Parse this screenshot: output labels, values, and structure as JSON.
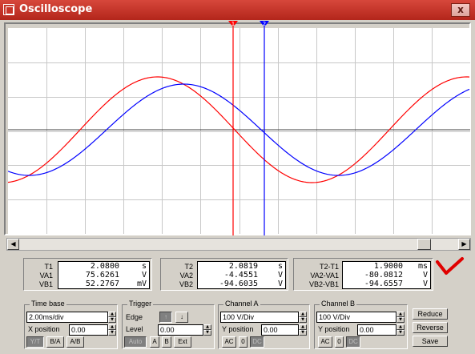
{
  "window": {
    "title": "Oscilloscope",
    "close_glyph": "x"
  },
  "scope": {
    "trace_colors": {
      "channel_a": "#ff0000",
      "channel_b": "#0000ff"
    },
    "cursor_labels": {
      "t1": "1",
      "t2": "2"
    },
    "cursor_colors": {
      "t1": "#ff0000",
      "t2": "#0000ff"
    }
  },
  "measurements": {
    "t1": {
      "label": "T1",
      "value": "2.0800",
      "unit": "s"
    },
    "va1": {
      "label": "VA1",
      "value": "75.6261",
      "unit": "V"
    },
    "vb1": {
      "label": "VB1",
      "value": "52.2767",
      "unit": "mV"
    },
    "t2": {
      "label": "T2",
      "value": "2.0819",
      "unit": "s"
    },
    "va2": {
      "label": "VA2",
      "value": "-4.4551",
      "unit": "V"
    },
    "vb2": {
      "label": "VB2",
      "value": "-94.6035",
      "unit": "V"
    },
    "t2_t1": {
      "label": "T2-T1",
      "value": "1.9000",
      "unit": "ms"
    },
    "va2_va1": {
      "label": "VA2-VA1",
      "value": "-80.0812",
      "unit": "V"
    },
    "vb2_vb1": {
      "label": "VB2-VB1",
      "value": "-94.6557",
      "unit": "V"
    }
  },
  "timebase": {
    "title": "Time base",
    "scale": "2.00ms/div",
    "xpos_label": "X position",
    "xpos": "0.00",
    "modes": [
      "Y/T",
      "B/A",
      "A/B"
    ],
    "selected_mode": "Y/T"
  },
  "trigger": {
    "title": "Trigger",
    "edge_label": "Edge",
    "edge_rising": "↑",
    "edge_falling": "↓",
    "level_label": "Level",
    "level": "0.00",
    "sources": [
      "Auto",
      "A",
      "B",
      "Ext"
    ]
  },
  "channel_a": {
    "title": "Channel A",
    "scale": "100 V/Div",
    "ypos_label": "Y position",
    "ypos": "0.00",
    "coupling": [
      "AC",
      "0",
      "DC"
    ],
    "selected": "DC"
  },
  "channel_b": {
    "title": "Channel B",
    "scale": "100 V/Div",
    "ypos_label": "Y position",
    "ypos": "0.00",
    "coupling": [
      "AC",
      "0",
      "DC"
    ],
    "selected": "DC"
  },
  "actions": {
    "reduce": "Reduce",
    "reverse": "Reverse",
    "save": "Save"
  }
}
